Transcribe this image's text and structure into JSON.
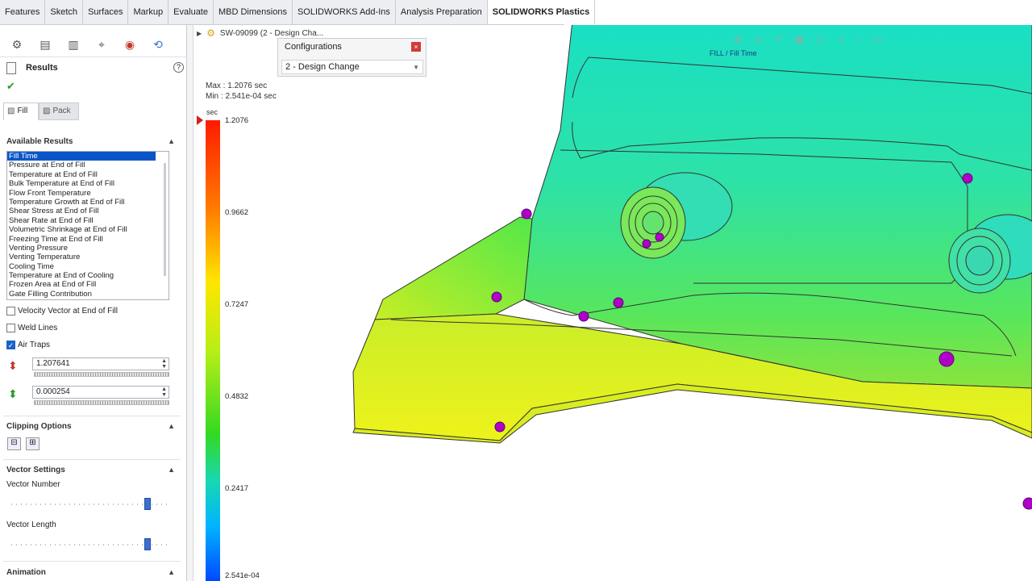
{
  "tabs": [
    "Features",
    "Sketch",
    "Surfaces",
    "Markup",
    "Evaluate",
    "MBD Dimensions",
    "SOLIDWORKS Add-Ins",
    "Analysis Preparation",
    "SOLIDWORKS Plastics"
  ],
  "active_tab_index": 8,
  "panel": {
    "title": "Results",
    "fill_tab": "Fill",
    "pack_tab": "Pack",
    "available_results_heading": "Available Results",
    "results": [
      "Fill Time",
      "Pressure at End of Fill",
      "Temperature at End of Fill",
      "Bulk Temperature at End of Fill",
      "Flow Front Temperature",
      "Temperature Growth at End of Fill",
      "Shear Stress at End of Fill",
      "Shear Rate at End of Fill",
      "Volumetric Shrinkage at End of Fill",
      "Freezing Time at End of Fill",
      "Venting Pressure",
      "Venting Temperature",
      "Cooling Time",
      "Temperature at End of Cooling",
      "Frozen Area at End of Fill",
      "Gate Filling Contribution"
    ],
    "selected_result": "Fill Time",
    "velocity_vector": "Velocity Vector at End of Fill",
    "weld_lines": "Weld Lines",
    "air_traps": "Air Traps",
    "air_traps_checked": true,
    "max_value": "1.207641",
    "min_value": "0.000254",
    "clipping_heading": "Clipping Options",
    "vector_heading": "Vector Settings",
    "vector_number_label": "Vector Number",
    "vector_length_label": "Vector Length",
    "vector_number_level": 0.86,
    "vector_length_level": 0.86,
    "animation_heading": "Animation"
  },
  "viewport": {
    "doc_title": "SW-09099 (2 - Design Cha...",
    "config_title": "Configurations",
    "config_value": "2 - Design Change",
    "max_line": "Max : 1.2076 sec",
    "min_line": "Min : 2.541e-04 sec",
    "unit": "sec",
    "scale_labels": [
      "1.2076",
      "0.9662",
      "0.7247",
      "0.4832",
      "0.2417",
      "2.541e-04"
    ],
    "plot_label": "FILL / Fill Time"
  },
  "colors": {
    "selection": "#0a56c8",
    "accent": "#3c6fd0",
    "air_trap": "#b000c8"
  }
}
